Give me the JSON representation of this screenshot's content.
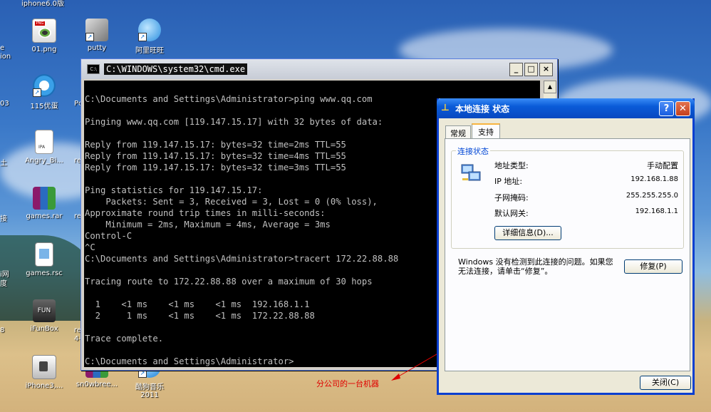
{
  "desktop": {
    "icons": [
      {
        "label": "01.png",
        "icon": "png-file-icon"
      },
      {
        "label": "putty",
        "icon": "putty-icon"
      },
      {
        "label": "阿里旺旺",
        "icon": "aliwangwang-icon"
      },
      {
        "label": "115优蛋",
        "icon": "115-icon"
      },
      {
        "label": "Angry_Bi...",
        "icon": "ipa-file-icon"
      },
      {
        "label": "games.rar",
        "icon": "rar-file-icon"
      },
      {
        "label": "games.rsc",
        "icon": "rsc-file-icon"
      },
      {
        "label": "iFunBox",
        "icon": "ifunbox-icon"
      },
      {
        "label": "iPhone3,...",
        "icon": "iphone-file-icon"
      },
      {
        "label": "sn0wbree...",
        "icon": "snowbreeze-icon"
      },
      {
        "label": "酷狗音乐 2011",
        "icon": "kugou-icon"
      }
    ],
    "partial_labels": [
      "iphone6.0版",
      "e",
      "ion",
      "03",
      "Pc",
      "土",
      "re",
      "接",
      "re",
      "i网",
      "度",
      "4-",
      "re",
      "8"
    ]
  },
  "cmd": {
    "title": "C:\\WINDOWS\\system32\\cmd.exe",
    "lines": [
      "C:\\Documents and Settings\\Administrator>ping www.qq.com",
      "",
      "Pinging www.qq.com [119.147.15.17] with 32 bytes of data:",
      "",
      "Reply from 119.147.15.17: bytes=32 time=2ms TTL=55",
      "Reply from 119.147.15.17: bytes=32 time=4ms TTL=55",
      "Reply from 119.147.15.17: bytes=32 time=3ms TTL=55",
      "",
      "Ping statistics for 119.147.15.17:",
      "    Packets: Sent = 3, Received = 3, Lost = 0 (0% loss),",
      "Approximate round trip times in milli-seconds:",
      "    Minimum = 2ms, Maximum = 4ms, Average = 3ms",
      "Control-C",
      "^C",
      "C:\\Documents and Settings\\Administrator>tracert 172.22.88.88",
      "",
      "Tracing route to 172.22.88.88 over a maximum of 30 hops",
      "",
      "  1    <1 ms    <1 ms    <1 ms  192.168.1.1",
      "  2     1 ms    <1 ms    <1 ms  172.22.88.88",
      "",
      "Trace complete.",
      "",
      "C:\\Documents and Settings\\Administrator>"
    ]
  },
  "annotation": {
    "text": "分公司的一台机器",
    "color": "#e00000"
  },
  "dialog": {
    "title": "本地连接 状态",
    "tabs": [
      "常规",
      "支持"
    ],
    "group_title": "连接状态",
    "fields": [
      {
        "label": "地址类型:",
        "value": "手动配置"
      },
      {
        "label": "IP 地址:",
        "value": "192.168.1.88"
      },
      {
        "label": "子网掩码:",
        "value": "255.255.255.0"
      },
      {
        "label": "默认网关:",
        "value": "192.168.1.1"
      }
    ],
    "details_button": "详细信息(D)...",
    "notice": "Windows 没有检测到此连接的问题。如果您无法连接，请单击“修复”。",
    "repair_button": "修复(P)",
    "close_button": "关闭(C)"
  },
  "colors": {
    "xp_title_blue": "#0a5bd8",
    "console_bg": "#000000",
    "console_fg": "#c0c0c0"
  }
}
